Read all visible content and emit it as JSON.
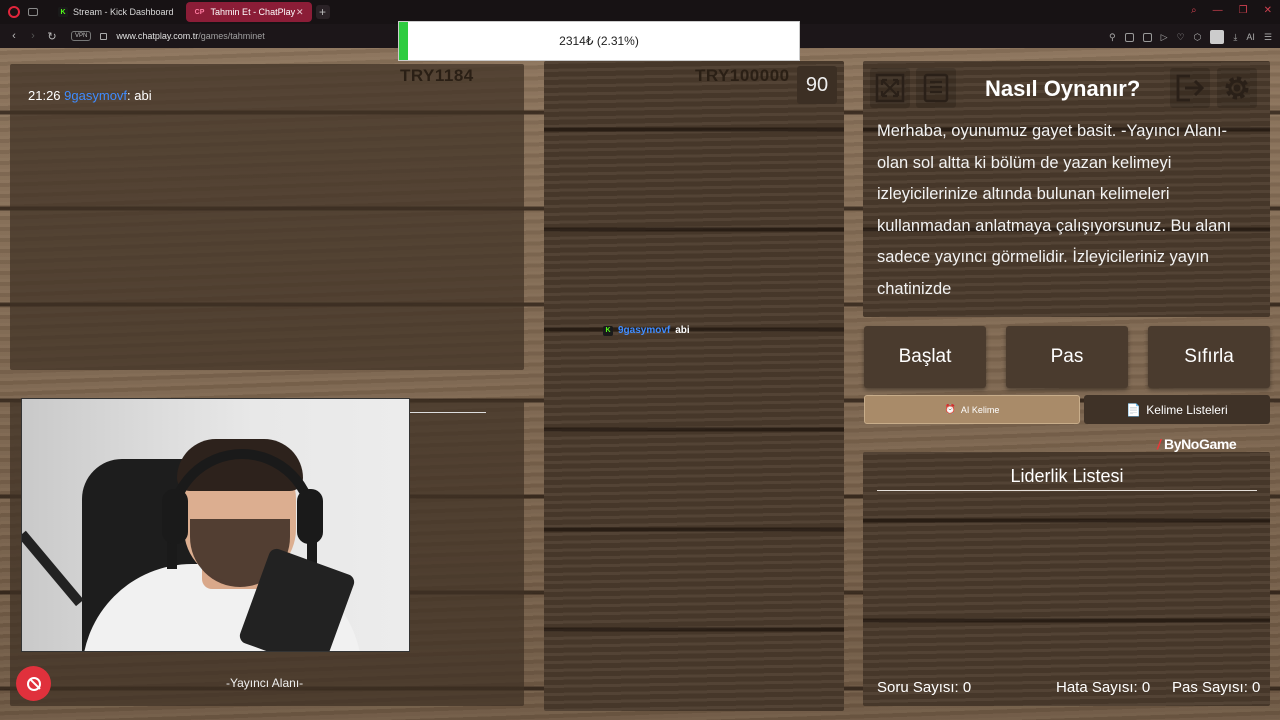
{
  "browser": {
    "tabs": [
      {
        "label": "Stream - Kick Dashboard",
        "favicon": "K"
      },
      {
        "label": "Tahmin Et - ChatPlay",
        "favicon": "CP"
      }
    ],
    "vpn_label": "VPN",
    "url_domain": "www.chatplay.com.tr",
    "url_path": "/games/tahminet"
  },
  "progress": {
    "text": "2314₺ (2.31%)",
    "percent": 2.31,
    "color": "#2ecc40"
  },
  "scores": {
    "left": "TRY1184",
    "right": "TRY100000",
    "timer": "90"
  },
  "chat": {
    "time": "21:26",
    "user": "9gasymovf",
    "message": ": abi"
  },
  "center_message": {
    "badge": "K",
    "user": "9gasymovf",
    "message": "abi"
  },
  "streamer_area_label": "-Yayıncı Alanı-",
  "how_to": {
    "title": "Nasıl Oynanır?",
    "text": "Merhaba, oyunumuz gayet basit. -Yayıncı Alanı- olan sol altta ki bölüm de yazan kelimeyi izleyicilerinize altında bulunan kelimeleri kullanmadan anlatmaya çalışıyorsunuz. Bu alanı sadece yayıncı görmelidir. İzleyicileriniz yayın chatinizde"
  },
  "buttons": {
    "start": "Başlat",
    "pass": "Pas",
    "reset": "Sıfırla",
    "ai_word": "AI Kelime",
    "word_lists": "Kelime Listeleri"
  },
  "brand": {
    "slash": "/",
    "name": "ByNoGame"
  },
  "leaderboard": {
    "title": "Liderlik Listesi"
  },
  "stats": {
    "questions_label": "Soru Sayısı:",
    "questions": "0",
    "errors_label": "Hata Sayısı:",
    "errors": "0",
    "passes_label": "Pas Sayısı:",
    "passes": "0"
  }
}
